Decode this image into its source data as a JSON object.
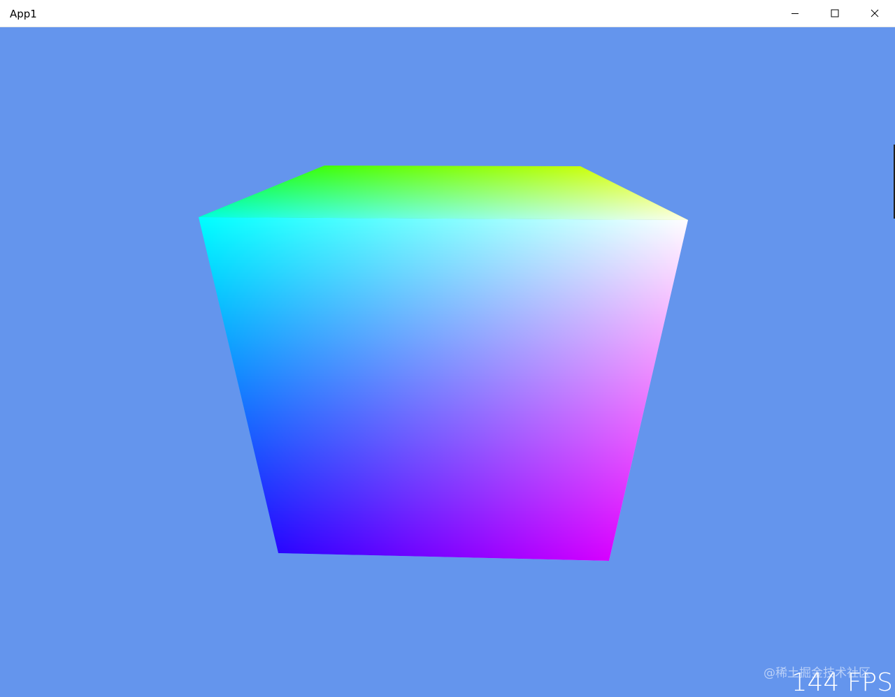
{
  "window": {
    "title": "App1",
    "background_color": "#6495ed"
  },
  "caption_buttons": {
    "minimize_icon": "minimize-icon",
    "maximize_icon": "maximize-icon",
    "close_icon": "close-icon"
  },
  "scene": {
    "object": "colored cube",
    "vertex_colors": [
      "#00ff00",
      "#ffff00",
      "#00ffff",
      "#ffffff",
      "#0000ff",
      "#ff00ff"
    ]
  },
  "overlay": {
    "fps_text": "144 FPS",
    "watermark_text": "@稀土掘金技术社区"
  }
}
